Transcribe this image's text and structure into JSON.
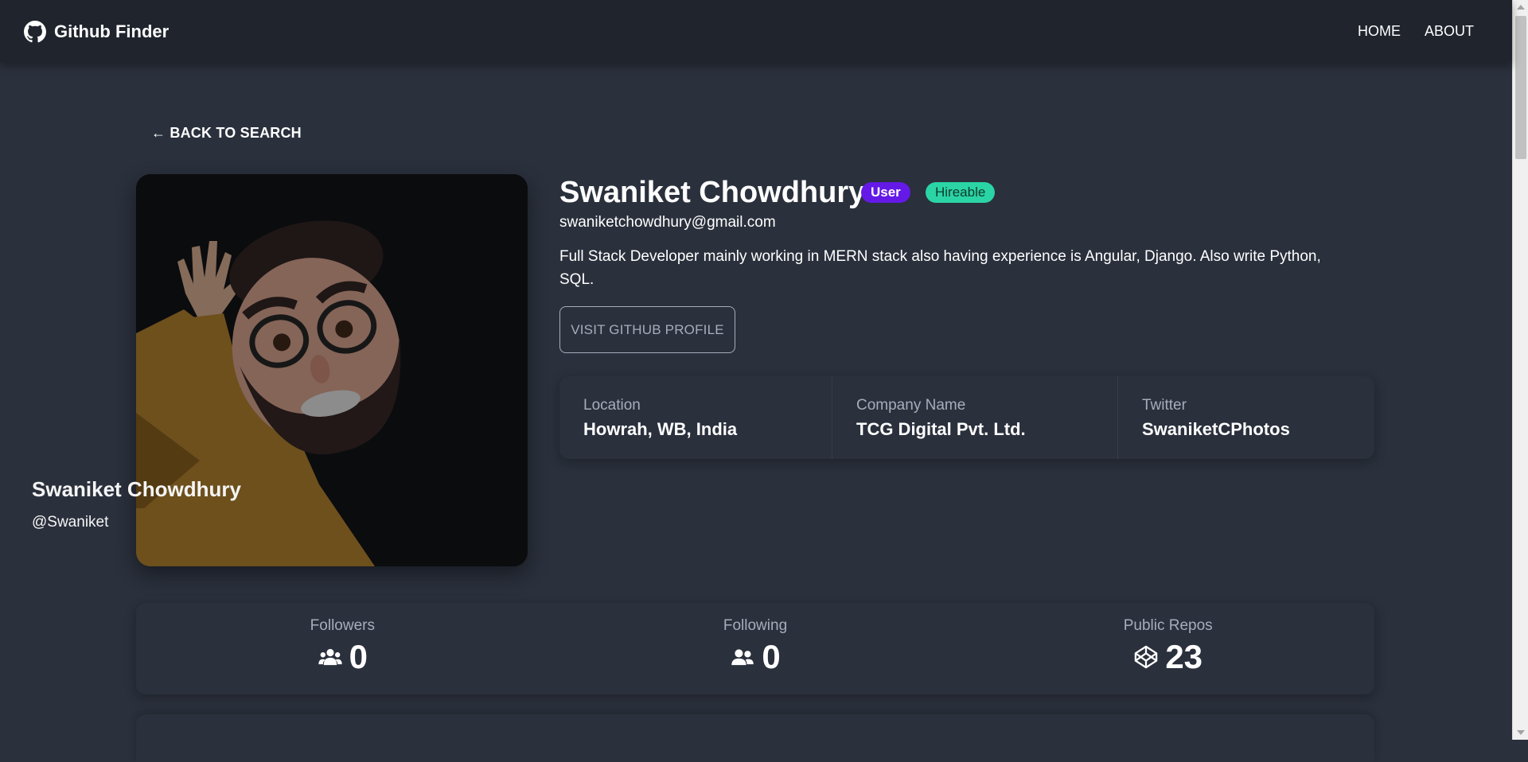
{
  "navbar": {
    "brand_title": "Github Finder",
    "brand_icon": "github-icon",
    "links": [
      "HOME",
      "ABOUT"
    ]
  },
  "back_link": "← BACK TO SEARCH",
  "avatar_card": {
    "name": "Swaniket Chowdhury",
    "login": "@Swaniket"
  },
  "profile": {
    "name": "Swaniket Chowdhury",
    "type_badge": "User",
    "hireable_badge": "Hireable",
    "email": "swaniketchowdhury@gmail.com",
    "bio": "Full Stack Developer mainly working in MERN stack also having experience is Angular, Django. Also write Python, SQL.",
    "visit_button": "VISIT GITHUB PROFILE"
  },
  "info": [
    {
      "title": "Location",
      "value": "Howrah, WB, India"
    },
    {
      "title": "Company Name",
      "value": "TCG Digital Pvt. Ltd."
    },
    {
      "title": "Twitter",
      "value": "SwaniketCPhotos"
    }
  ],
  "counts": [
    {
      "title": "Followers",
      "value": "0",
      "icon": "users-icon"
    },
    {
      "title": "Following",
      "value": "0",
      "icon": "user-friends-icon"
    },
    {
      "title": "Public Repos",
      "value": "23",
      "icon": "codepen-icon"
    }
  ],
  "colors": {
    "background": "#2a303c",
    "navbar": "#1f242d",
    "badge_user": "#6419e6",
    "badge_hireable": "#2bd4a4",
    "muted_text": "#a6adbb"
  }
}
